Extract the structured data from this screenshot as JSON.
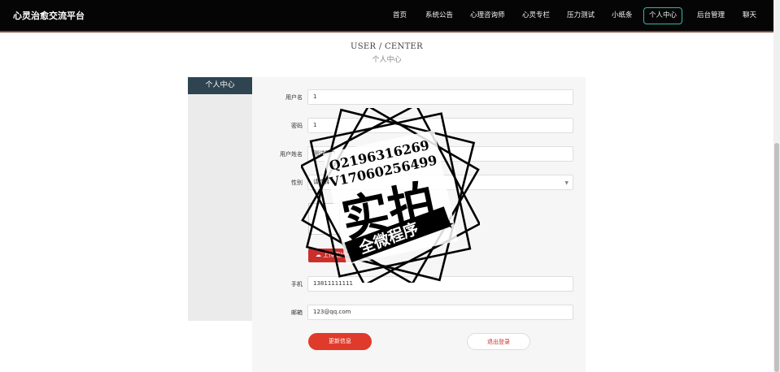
{
  "nav": {
    "brand": "心灵治愈交流平台",
    "items": [
      "首页",
      "系统公告",
      "心理咨询师",
      "心灵专栏",
      "压力测试",
      "小纸条",
      "个人中心",
      "后台管理",
      "聊天"
    ]
  },
  "heading": {
    "en": "USER / CENTER",
    "cn": "个人中心"
  },
  "sidebar": {
    "title": "个人中心"
  },
  "form": {
    "username_label": "用户名",
    "username": "1",
    "password_label": "密码",
    "password": "1",
    "realname_label": "用户姓名",
    "realname": "测试用户",
    "gender_label": "性别",
    "gender": "请选择",
    "upload_label": "上传图片",
    "phone_label": "手机",
    "phone": "13811111111",
    "email_label": "邮箱",
    "email": "123@qq.com"
  },
  "buttons": {
    "update": "更新信息",
    "logout": "退出登录"
  },
  "watermark": {
    "line1": "Q2196316269",
    "line2": "V17060256499",
    "big": "实拍",
    "banner": "全微程序"
  },
  "colors": {
    "nav_bg": "#050505",
    "active_border": "#35b6a8",
    "primary": "#e03a2a",
    "sidebar_head": "#2f4451"
  }
}
